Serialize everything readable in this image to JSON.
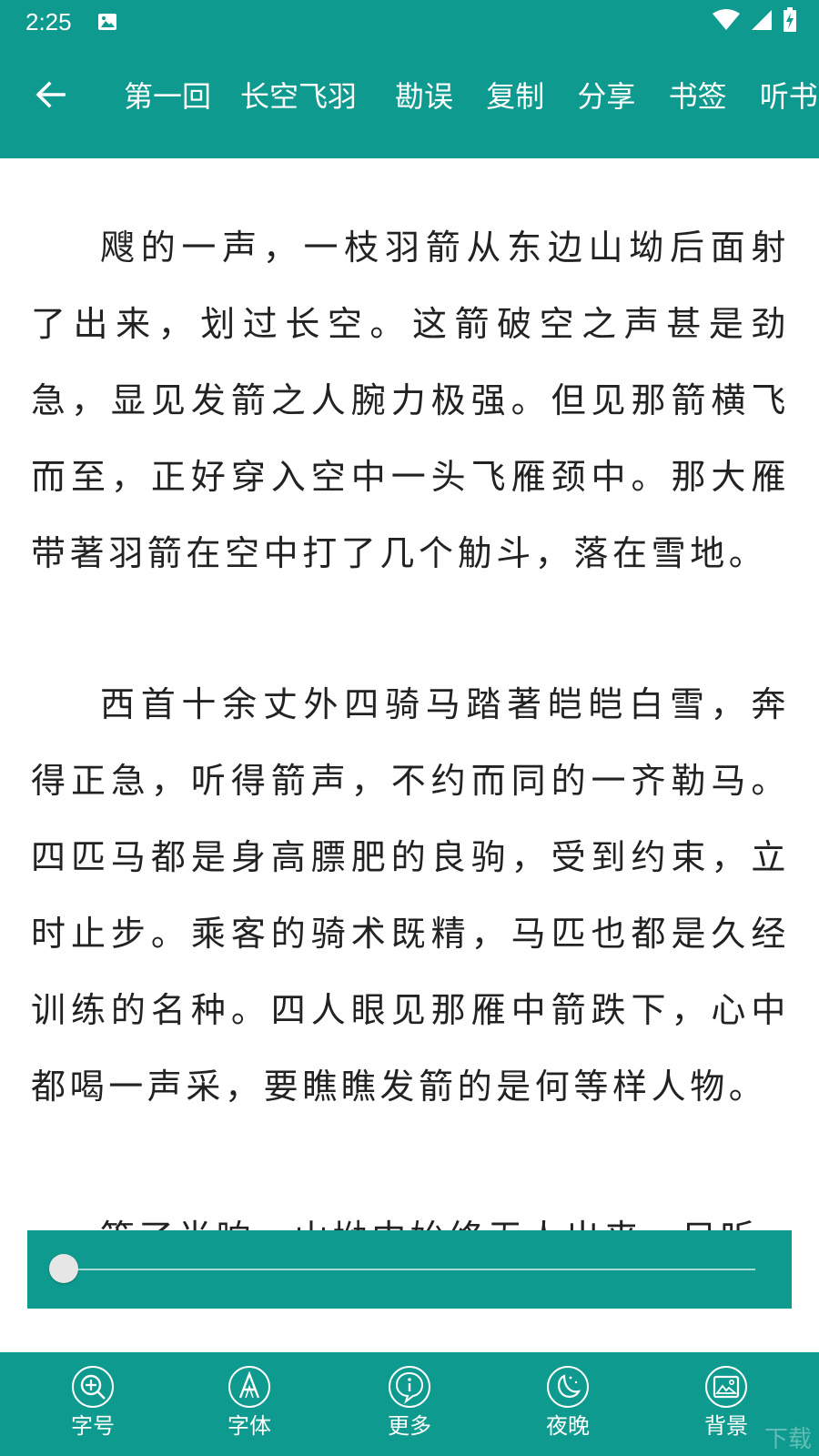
{
  "status_bar": {
    "time": "2:25",
    "icons": [
      "image-icon",
      "wifi-icon",
      "signal-icon",
      "battery-charging-icon"
    ]
  },
  "toolbar": {
    "back_icon": "arrow-left-icon",
    "chapter_number": "第一回",
    "chapter_name": "长空飞羽",
    "actions": [
      "勘误",
      "复制",
      "分享",
      "书签",
      "听书"
    ]
  },
  "content": {
    "paragraphs": [
      "飕的一声，一枝羽箭从东边山坳后面射了出来，划过长空。这箭破空之声甚是劲急，显见发箭之人腕力极强。但见那箭横飞而至，正好穿入空中一头飞雁颈中。那大雁带著羽箭在空中打了几个觔斗，落在雪地。",
      "西首十余丈外四骑马踏著皑皑白雪，奔得正急，听得箭声，不约而同的一齐勒马。四匹马都是身高膘肥的良驹，受到约束，立时止步。乘客的骑术既精，马匹也都是久经训练的名种。四人眼见那雁中箭跌下，心中都喝一声采，要瞧瞧发箭的是何等样人物。",
      "等了半晌，山坳中始终无人出来，只听"
    ]
  },
  "progress": {
    "value": 0
  },
  "bottom_bar": {
    "items": [
      {
        "label": "字号",
        "icon": "zoom-plus-icon"
      },
      {
        "label": "字体",
        "icon": "font-a-icon"
      },
      {
        "label": "更多",
        "icon": "info-icon"
      },
      {
        "label": "夜晚",
        "icon": "moon-icon"
      },
      {
        "label": "背景",
        "icon": "image-frame-icon"
      }
    ],
    "watermark": "下载"
  },
  "colors": {
    "primary": "#0e9a8e",
    "text": "#222222",
    "background": "#ffffff"
  }
}
